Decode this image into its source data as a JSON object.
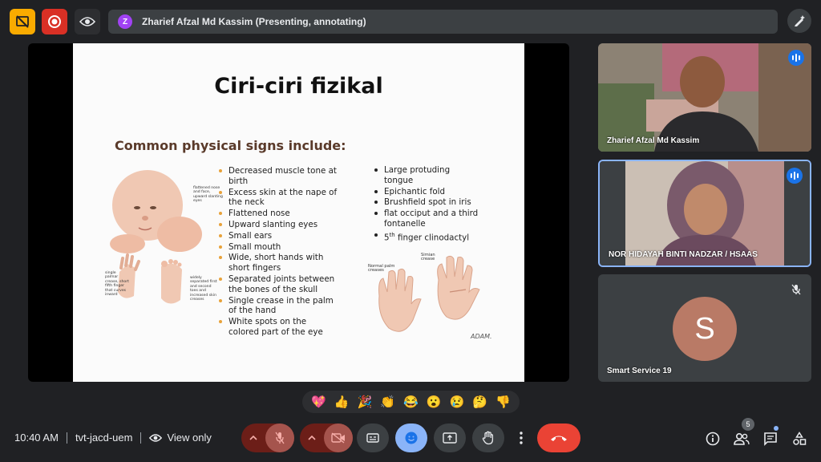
{
  "presenter": {
    "avatar_letter": "Z",
    "label": "Zharief Afzal Md Kassim (Presenting, annotating)"
  },
  "slide": {
    "title": "Ciri-ciri fizikal",
    "subtitle": "Common physical signs include:",
    "left_bullets": [
      "Decreased muscle tone at birth",
      "Excess skin at the nape of the neck",
      "Flattened nose",
      "Upward slanting eyes",
      "Small ears",
      "Small mouth",
      "Wide, short hands with short fingers",
      "Separated joints between the bones of the skull",
      "Single crease in the palm of the hand",
      "White spots on the colored part of the eye"
    ],
    "right_bullets": [
      "Large protuding tongue",
      "Epichantic fold",
      "Brushfield spot in iris",
      "flat occiput and a third fontanelle",
      "5th finger clinodactyl"
    ],
    "label_face": "flattened nose and face, upward slanting eyes",
    "label_palm": "single palmar crease, short fifth finger that curves inward",
    "label_toes": "widely separated first and second toes and increased skin creases",
    "label_normal": "Normal palm creases",
    "label_simian": "Simian crease",
    "credit": "ADAM."
  },
  "participants": [
    {
      "name": "Zharief Afzal Md Kassim",
      "status": "speaking"
    },
    {
      "name": "NOR HIDAYAH BINTI NADZAR / HSAAS",
      "status": "speaking"
    },
    {
      "name": "Smart Service 19",
      "avatar_letter": "S",
      "status": "muted"
    }
  ],
  "reactions": [
    "💖",
    "👍",
    "🎉",
    "👏",
    "😂",
    "😮",
    "😢",
    "🤔",
    "👎"
  ],
  "bottom": {
    "time": "10:40 AM",
    "meeting_code": "tvt-jacd-uem",
    "view_mode": "View only",
    "people_count": "5"
  },
  "colors": {
    "background": "#202124",
    "tile": "#3c4043",
    "accent_blue": "#1a73e8",
    "end_call_red": "#ea4335",
    "record_red": "#d93025",
    "warning_yellow": "#f9ab00"
  }
}
